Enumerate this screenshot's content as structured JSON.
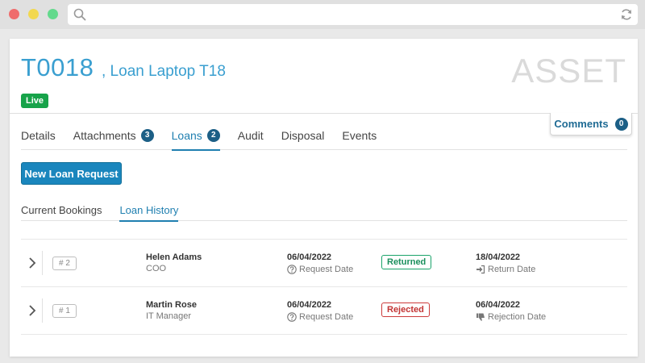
{
  "asset": {
    "code": "T0018",
    "name": ", Loan Laptop T18",
    "status": "Live",
    "watermark": "ASSET"
  },
  "comments": {
    "label": "Comments",
    "count": "0"
  },
  "tabs": [
    {
      "label": "Details"
    },
    {
      "label": "Attachments",
      "count": "3"
    },
    {
      "label": "Loans",
      "count": "2",
      "active": true
    },
    {
      "label": "Audit"
    },
    {
      "label": "Disposal"
    },
    {
      "label": "Events"
    }
  ],
  "actions": {
    "new_loan_label": "New Loan Request"
  },
  "subtabs": [
    {
      "label": "Current Bookings"
    },
    {
      "label": "Loan History",
      "active": true
    }
  ],
  "loans": [
    {
      "number": "# 2",
      "name": "Helen Adams",
      "role": "COO",
      "request_date": "06/04/2022",
      "request_label": "Request Date",
      "status": "Returned",
      "end_date": "18/04/2022",
      "end_label": "Return Date",
      "end_icon": "sign-in-icon"
    },
    {
      "number": "# 1",
      "name": "Martin Rose",
      "role": "IT Manager",
      "request_date": "06/04/2022",
      "request_label": "Request Date",
      "status": "Rejected",
      "end_date": "06/04/2022",
      "end_label": "Rejection Date",
      "end_icon": "thumbs-down-icon"
    }
  ],
  "colors": {
    "accent": "#1f7fb0",
    "live": "#17a34a",
    "returned": "#1a8f5c",
    "rejected": "#c23232"
  }
}
